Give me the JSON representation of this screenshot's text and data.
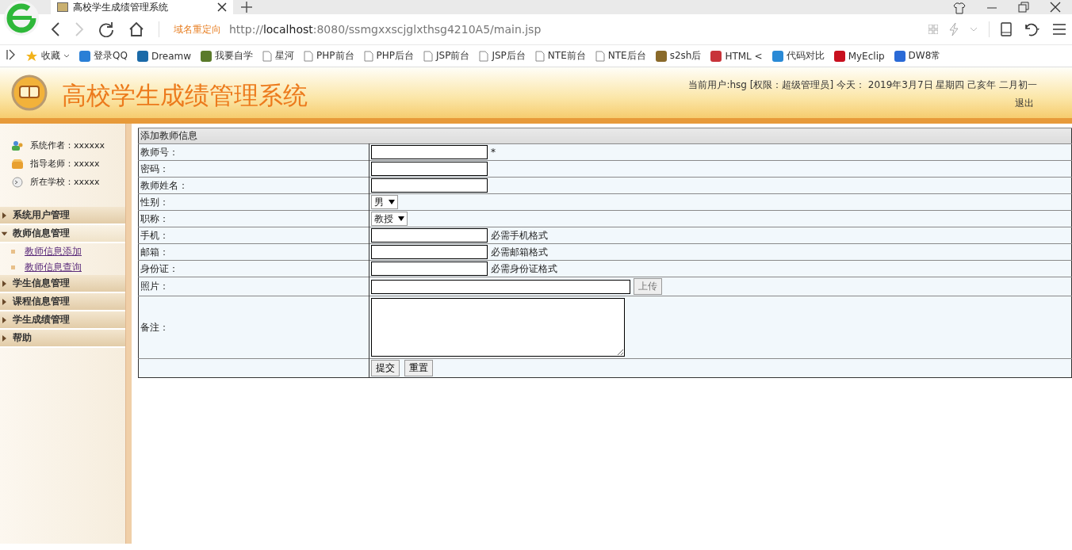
{
  "browser": {
    "tab": {
      "title": "高校学生成绩管理系统",
      "selected": true
    },
    "redirect_label": "域名重定向",
    "url": {
      "scheme": "http://",
      "host": "localhost",
      "rest": ":8080/ssmgxxscjglxthsg4210A5/main.jsp"
    },
    "bookmarks": [
      {
        "kind": "star",
        "label": "收藏"
      },
      {
        "kind": "app",
        "label": "登录QQ",
        "color": "#2a7fd6"
      },
      {
        "kind": "app",
        "label": "Dreamw",
        "color": "#1b6aa8"
      },
      {
        "kind": "app",
        "label": "我要自学",
        "color": "#5a7a2a"
      },
      {
        "kind": "page",
        "label": "星河"
      },
      {
        "kind": "page",
        "label": "PHP前台"
      },
      {
        "kind": "page",
        "label": "PHP后台"
      },
      {
        "kind": "page",
        "label": "JSP前台"
      },
      {
        "kind": "page",
        "label": "JSP后台"
      },
      {
        "kind": "page",
        "label": "NTE前台"
      },
      {
        "kind": "page",
        "label": "NTE后台"
      },
      {
        "kind": "app",
        "label": "s2sh后",
        "color": "#8a6a2a"
      },
      {
        "kind": "app",
        "label": "HTML <",
        "color": "#c8343a"
      },
      {
        "kind": "app",
        "label": "代码对比",
        "color": "#2a8ad6"
      },
      {
        "kind": "app",
        "label": "MyEclip",
        "color": "#c8101e"
      },
      {
        "kind": "app",
        "label": "DW8常",
        "color": "#2a6ad6"
      }
    ]
  },
  "header": {
    "title": "高校学生成绩管理系统",
    "user_info": "当前用户:hsg [权限：超级管理员] 今天： 2019年3月7日 星期四 己亥年 二月初一",
    "logout": "退出"
  },
  "sidebar": {
    "info": [
      {
        "kind": "author",
        "text": "系统作者：xxxxxx"
      },
      {
        "kind": "teacher",
        "text": "指导老师：xxxxx"
      },
      {
        "kind": "school",
        "text": "所在学校：xxxxx"
      }
    ],
    "menu": [
      {
        "label": "系统用户管理",
        "expanded": false
      },
      {
        "label": "教师信息管理",
        "expanded": true,
        "children": [
          {
            "label": "教师信息添加"
          },
          {
            "label": "教师信息查询"
          }
        ]
      },
      {
        "label": "学生信息管理",
        "expanded": false
      },
      {
        "label": "课程信息管理",
        "expanded": false
      },
      {
        "label": "学生成绩管理",
        "expanded": false
      },
      {
        "label": "帮助",
        "expanded": false
      }
    ]
  },
  "form": {
    "title": "添加教师信息",
    "rows": [
      {
        "label": "教师号：",
        "kind": "text",
        "hint": "*"
      },
      {
        "label": "密码：",
        "kind": "text"
      },
      {
        "label": "教师姓名：",
        "kind": "text"
      },
      {
        "label": "性别：",
        "kind": "select",
        "value": "男"
      },
      {
        "label": "职称：",
        "kind": "select",
        "value": "教授"
      },
      {
        "label": "手机：",
        "kind": "text",
        "hint": "必需手机格式"
      },
      {
        "label": "邮箱：",
        "kind": "text",
        "hint": "必需邮箱格式"
      },
      {
        "label": "身份证：",
        "kind": "text",
        "hint": "必需身份证格式"
      },
      {
        "label": "照片：",
        "kind": "file",
        "button": "上传"
      },
      {
        "label": "备注：",
        "kind": "textarea"
      },
      {
        "kind": "buttons",
        "buttons": [
          "提交",
          "重置"
        ]
      }
    ]
  }
}
